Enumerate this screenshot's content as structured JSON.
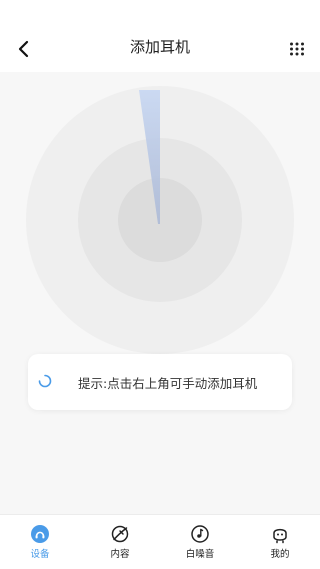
{
  "header": {
    "title": "添加耳机",
    "back_icon": "chevron-left-icon",
    "more_icon": "grid-dots-icon"
  },
  "tip": {
    "text": "提示:点击右上角可手动添加耳机",
    "icon": "loading-spinner-icon",
    "accent": "#4a9be8"
  },
  "tabbar": {
    "accent": "#4a9be8",
    "items": [
      {
        "label": "设备",
        "icon": "device-icon",
        "active": true
      },
      {
        "label": "内容",
        "icon": "content-icon",
        "active": false
      },
      {
        "label": "白噪音",
        "icon": "white-noise-icon",
        "active": false
      },
      {
        "label": "我的",
        "icon": "profile-icon",
        "active": false
      }
    ]
  }
}
